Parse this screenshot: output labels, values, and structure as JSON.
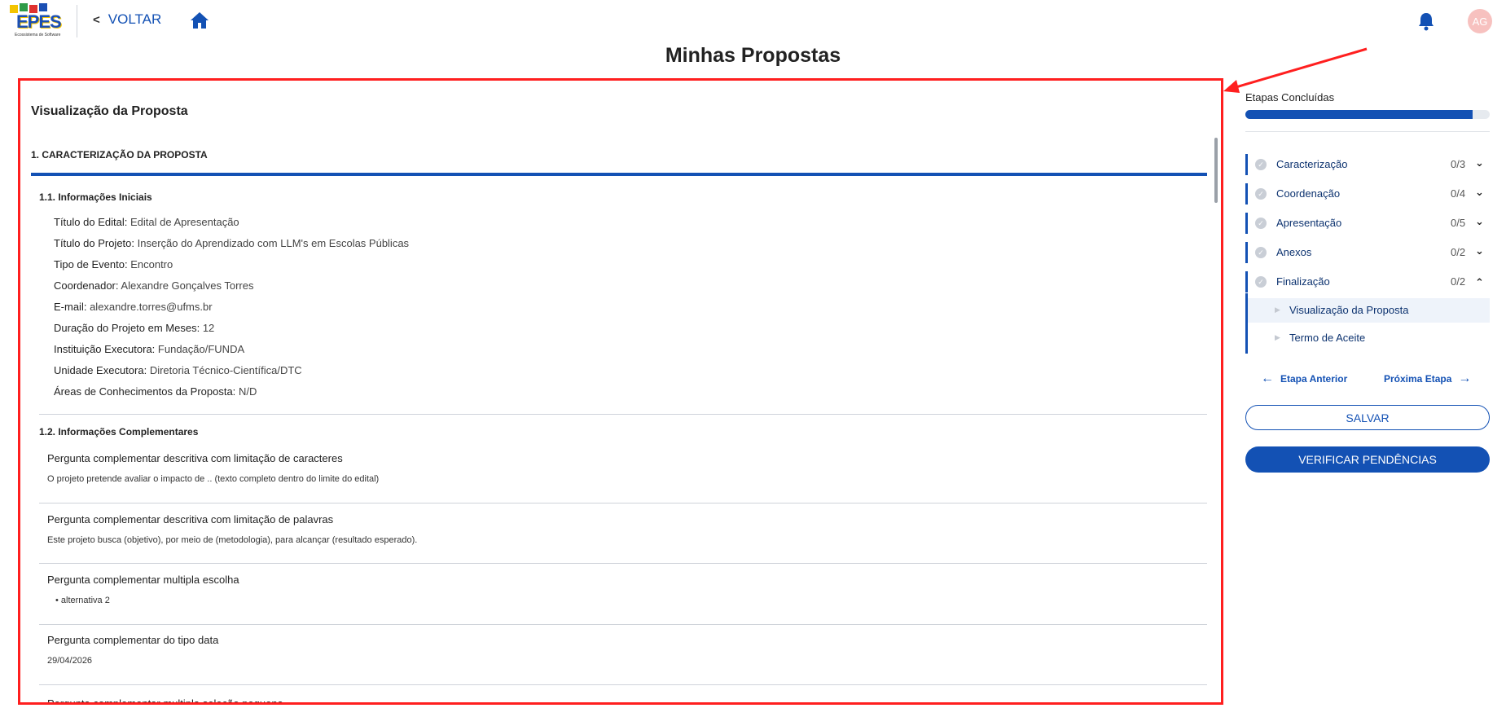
{
  "header": {
    "logo_text": "EPES",
    "logo_subtext": "Ecossistema de Software",
    "back_label": "VOLTAR",
    "avatar_initials": "AG"
  },
  "page_title": "Minhas Propostas",
  "proposal": {
    "title": "Visualização da Proposta",
    "section1": "1. CARACTERIZAÇÃO DA PROPOSTA",
    "sub1": "1.1. Informações Iniciais",
    "fields": [
      {
        "label": "Título do Edital:",
        "value": "Edital de Apresentação"
      },
      {
        "label": "Título do Projeto:",
        "value": "Inserção do Aprendizado com LLM's em Escolas Públicas"
      },
      {
        "label": "Tipo de Evento:",
        "value": "Encontro"
      },
      {
        "label": "Coordenador:",
        "value": "Alexandre Gonçalves Torres"
      },
      {
        "label": "E-mail:",
        "value": "alexandre.torres@ufms.br"
      },
      {
        "label": "Duração do Projeto em Meses:",
        "value": "12"
      },
      {
        "label": "Instituição Executora:",
        "value": "Fundação/FUNDA"
      },
      {
        "label": "Unidade Executora:",
        "value": "Diretoria Técnico-Científica/DTC"
      },
      {
        "label": "Áreas de Conhecimentos da Proposta:",
        "value": "N/D"
      }
    ],
    "sub2": "1.2. Informações Complementares",
    "questions": [
      {
        "q": "Pergunta complementar descritiva com limitação de caracteres",
        "a": "O projeto pretende avaliar o impacto de .. (texto completo dentro do limite do edital)"
      },
      {
        "q": "Pergunta complementar descritiva com limitação de palavras",
        "a": "Este projeto busca (objetivo), por meio de (metodologia), para alcançar (resultado esperado)."
      },
      {
        "q": "Pergunta complementar multipla escolha",
        "a": "• alternativa 2"
      },
      {
        "q": "Pergunta complementar do tipo data",
        "a": "29/04/2026"
      },
      {
        "q": "Pergunta complementar multipla seleção pequena",
        "a": ""
      }
    ]
  },
  "sidebar": {
    "stages_label": "Etapas Concluídas",
    "progress": 0.93,
    "steps": [
      {
        "name": "Caracterização",
        "count": "0/3",
        "chevron": "down"
      },
      {
        "name": "Coordenação",
        "count": "0/4",
        "chevron": "down"
      },
      {
        "name": "Apresentação",
        "count": "0/5",
        "chevron": "down"
      },
      {
        "name": "Anexos",
        "count": "0/2",
        "chevron": "down"
      },
      {
        "name": "Finalização",
        "count": "0/2",
        "chevron": "up"
      }
    ],
    "substeps": [
      {
        "name": "Visualização da Proposta",
        "active": true
      },
      {
        "name": "Termo de Aceite",
        "active": false
      }
    ],
    "prev_label": "Etapa Anterior",
    "next_label": "Próxima Etapa",
    "save_label": "SALVAR",
    "check_label": "VERIFICAR PENDÊNCIAS"
  },
  "colors": {
    "primary": "#1351b4",
    "highlight_border": "#ff1f1f",
    "avatar_bg": "#f7c1bf"
  }
}
